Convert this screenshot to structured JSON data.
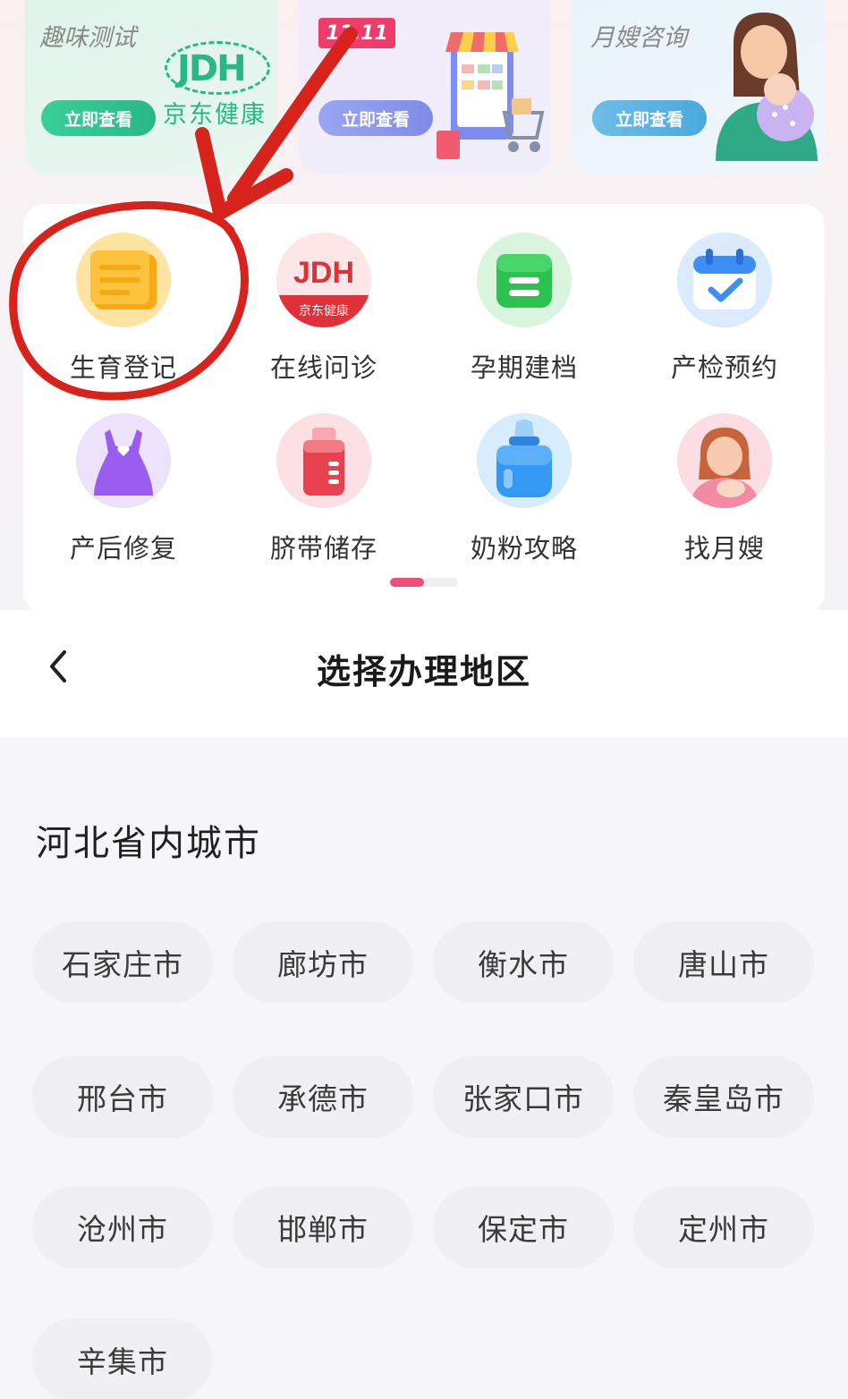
{
  "promos": [
    {
      "title": "",
      "subtitle": "趣味测试",
      "button": "立即查看",
      "logo_text": "JDH",
      "logo_cn": "京东健康"
    },
    {
      "badge": "11.11",
      "button": "立即查看"
    },
    {
      "title": "",
      "subtitle": "月嫂咨询",
      "button": "立即查看"
    }
  ],
  "services": [
    {
      "label": "生育登记",
      "icon": "register-scroll-icon",
      "color": "#f6b21f"
    },
    {
      "label": "在线问诊",
      "icon": "jdh-consult-icon",
      "color": "#e0303a",
      "icon_text": "JDH",
      "icon_sub": "京东健康"
    },
    {
      "label": "孕期建档",
      "icon": "record-folder-icon",
      "color": "#2cc24f"
    },
    {
      "label": "产检预约",
      "icon": "calendar-check-icon",
      "color": "#3d8ff5"
    },
    {
      "label": "产后修复",
      "icon": "dress-icon",
      "color": "#9b5cf0"
    },
    {
      "label": "脐带储存",
      "icon": "storage-bottle-icon",
      "color": "#e8414f"
    },
    {
      "label": "奶粉攻略",
      "icon": "milk-bottle-icon",
      "color": "#3598f3"
    },
    {
      "label": "找月嫂",
      "icon": "nanny-avatar-icon",
      "color": "#f28aa2"
    }
  ],
  "pager": {
    "pages": 2,
    "current": 1,
    "active_color": "#f24d7a"
  },
  "sheet": {
    "title": "选择办理地区",
    "section_title": "河北省内城市",
    "cities": [
      "石家庄市",
      "廊坊市",
      "衡水市",
      "唐山市",
      "邢台市",
      "承德市",
      "张家口市",
      "秦皇岛市",
      "沧州市",
      "邯郸市",
      "保定市",
      "定州市",
      "辛集市"
    ]
  },
  "annotation": {
    "color": "#d8231d"
  }
}
